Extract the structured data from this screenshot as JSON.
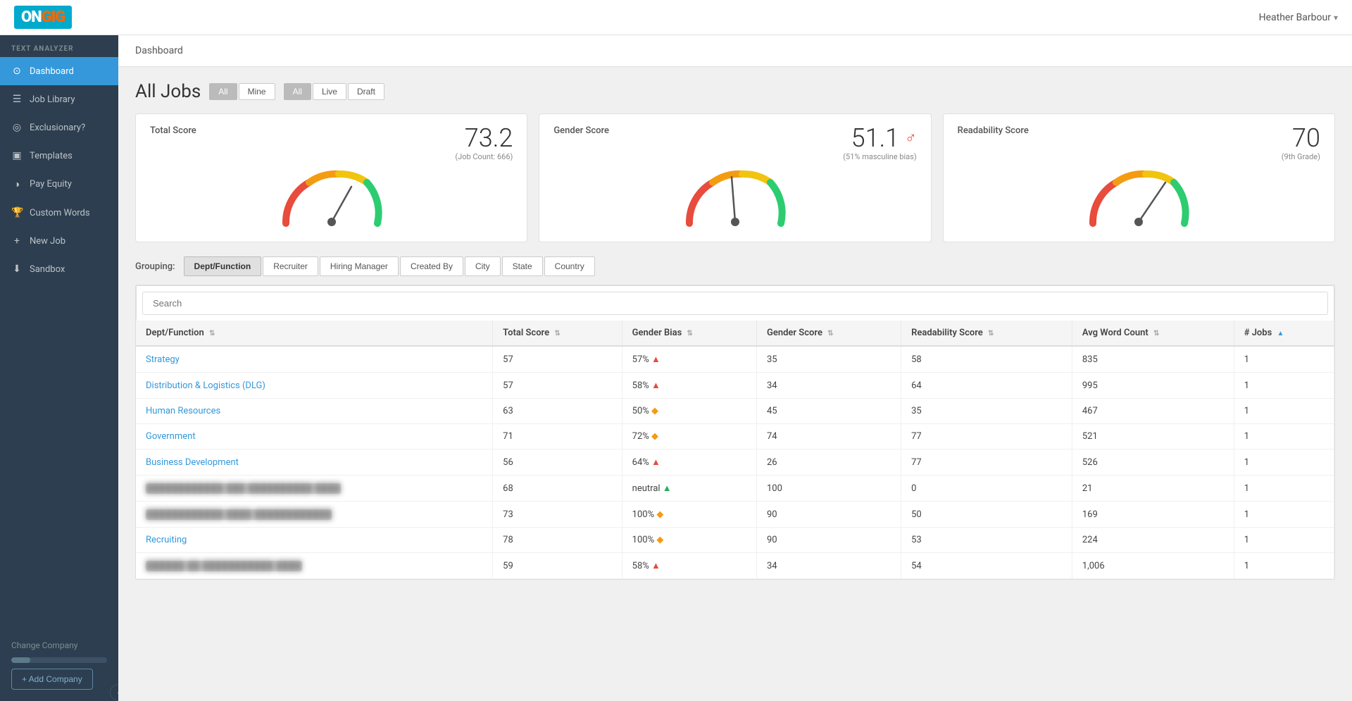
{
  "topNav": {
    "logo": "ONGIG",
    "user": "Heather Barbour"
  },
  "sidebar": {
    "sectionLabel": "TEXT ANALYZER",
    "items": [
      {
        "id": "dashboard",
        "label": "Dashboard",
        "icon": "⊙",
        "active": true
      },
      {
        "id": "job-library",
        "label": "Job Library",
        "icon": "☰"
      },
      {
        "id": "exclusionary",
        "label": "Exclusionary?",
        "icon": "◎"
      },
      {
        "id": "templates",
        "label": "Templates",
        "icon": "▣"
      },
      {
        "id": "pay-equity",
        "label": "Pay Equity",
        "icon": "◑"
      },
      {
        "id": "custom-words",
        "label": "Custom Words",
        "icon": "🏆"
      },
      {
        "id": "new-job",
        "label": "New Job",
        "icon": "+"
      },
      {
        "id": "sandbox",
        "label": "Sandbox",
        "icon": "⬇"
      }
    ],
    "changeCompany": "Change Company",
    "addCompany": "+ Add Company"
  },
  "pageHeader": {
    "breadcrumb": "Dashboard"
  },
  "allJobs": {
    "title": "All Jobs",
    "filterGroup1": {
      "buttons": [
        "All",
        "Mine"
      ],
      "active": "All"
    },
    "filterGroup2": {
      "buttons": [
        "All",
        "Live",
        "Draft"
      ],
      "active": "All"
    }
  },
  "scoreCards": [
    {
      "id": "total-score",
      "title": "Total Score",
      "value": "73.2",
      "sub": "(Job Count: 666)",
      "gaugeType": "total",
      "needleAngle": -10
    },
    {
      "id": "gender-score",
      "title": "Gender Score",
      "value": "51.1",
      "sub": "(51% masculine bias)",
      "hasGenderIcon": true,
      "gaugeType": "gender",
      "needleAngle": 5
    },
    {
      "id": "readability-score",
      "title": "Readability Score",
      "value": "70",
      "sub": "(9th Grade)",
      "gaugeType": "readability",
      "needleAngle": -5
    }
  ],
  "grouping": {
    "label": "Grouping:",
    "tabs": [
      "Dept/Function",
      "Recruiter",
      "Hiring Manager",
      "Created By",
      "City",
      "State",
      "Country"
    ],
    "active": "Dept/Function"
  },
  "search": {
    "placeholder": "Search"
  },
  "table": {
    "columns": [
      {
        "id": "dept",
        "label": "Dept/Function",
        "sortable": true,
        "sortActive": false
      },
      {
        "id": "total-score",
        "label": "Total Score",
        "sortable": true,
        "sortActive": false
      },
      {
        "id": "gender-bias",
        "label": "Gender Bias",
        "sortable": true,
        "sortActive": false
      },
      {
        "id": "gender-score",
        "label": "Gender Score",
        "sortable": true,
        "sortActive": false
      },
      {
        "id": "readability-score",
        "label": "Readability Score",
        "sortable": true,
        "sortActive": false
      },
      {
        "id": "avg-word-count",
        "label": "Avg Word Count",
        "sortable": true,
        "sortActive": false
      },
      {
        "id": "num-jobs",
        "label": "# Jobs",
        "sortable": true,
        "sortActive": true,
        "sortDir": "asc"
      }
    ],
    "rows": [
      {
        "dept": "Strategy",
        "deptLink": true,
        "totalScore": 57,
        "genderBias": "57%",
        "genderBiasType": "up",
        "genderScore": 35,
        "readabilityScore": 58,
        "avgWordCount": 835,
        "numJobs": 1
      },
      {
        "dept": "Distribution & Logistics (DLG)",
        "deptLink": true,
        "totalScore": 57,
        "genderBias": "58%",
        "genderBiasType": "up",
        "genderScore": 34,
        "readabilityScore": 64,
        "avgWordCount": 995,
        "numJobs": 1
      },
      {
        "dept": "Human Resources",
        "deptLink": true,
        "totalScore": 63,
        "genderBias": "50%",
        "genderBiasType": "yellow",
        "genderScore": 45,
        "readabilityScore": 35,
        "avgWordCount": 467,
        "numJobs": 1
      },
      {
        "dept": "Government",
        "deptLink": true,
        "totalScore": 71,
        "genderBias": "72%",
        "genderBiasType": "yellow",
        "genderScore": 74,
        "readabilityScore": 77,
        "avgWordCount": 521,
        "numJobs": 1
      },
      {
        "dept": "Business Development",
        "deptLink": true,
        "totalScore": 56,
        "genderBias": "64%",
        "genderBiasType": "up",
        "genderScore": 26,
        "readabilityScore": 77,
        "avgWordCount": 526,
        "numJobs": 1
      },
      {
        "dept": "BLURRED_ROW_1",
        "deptLink": false,
        "totalScore": 68,
        "genderBias": "neutral",
        "genderBiasType": "neutral",
        "genderScore": 100,
        "readabilityScore": 0,
        "avgWordCount": 21,
        "numJobs": 1
      },
      {
        "dept": "BLURRED_ROW_2",
        "deptLink": false,
        "totalScore": 73,
        "genderBias": "100%",
        "genderBiasType": "yellow",
        "genderScore": 90,
        "readabilityScore": 50,
        "avgWordCount": 169,
        "numJobs": 1
      },
      {
        "dept": "Recruiting",
        "deptLink": true,
        "totalScore": 78,
        "genderBias": "100%",
        "genderBiasType": "yellow",
        "genderScore": 90,
        "readabilityScore": 53,
        "avgWordCount": 224,
        "numJobs": 1
      },
      {
        "dept": "BLURRED_ROW_3",
        "deptLink": false,
        "totalScore": 59,
        "genderBias": "58%",
        "genderBiasType": "up",
        "genderScore": 34,
        "readabilityScore": 54,
        "avgWordCount": 1006,
        "numJobs": 1
      }
    ]
  }
}
